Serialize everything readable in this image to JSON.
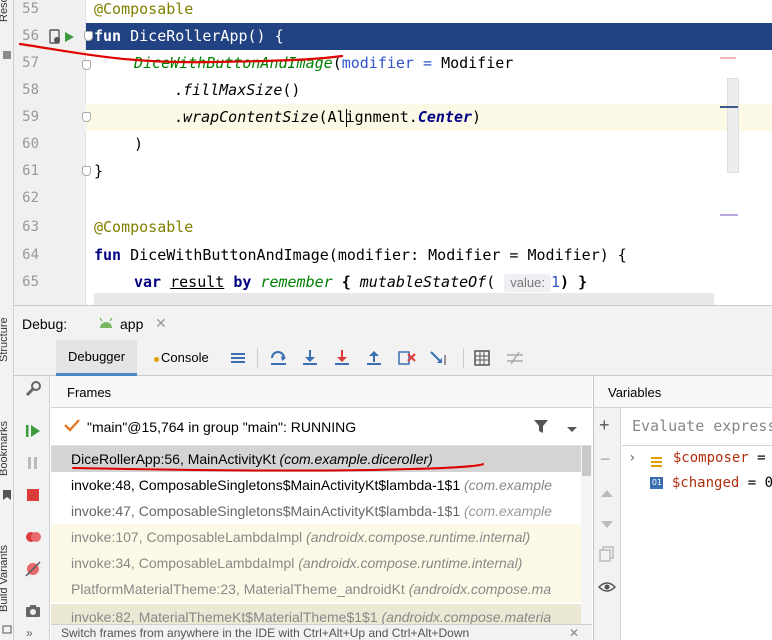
{
  "side_labels": {
    "resource": "Resource",
    "structure": "Structure",
    "bookmarks": "Bookmarks",
    "build_variants": "Build Variants"
  },
  "editor": {
    "lines": [
      {
        "n": "55"
      },
      {
        "n": "56"
      },
      {
        "n": "57"
      },
      {
        "n": "58"
      },
      {
        "n": "59"
      },
      {
        "n": "60"
      },
      {
        "n": "61"
      },
      {
        "n": "62"
      },
      {
        "n": "63"
      },
      {
        "n": "64"
      },
      {
        "n": "65"
      }
    ],
    "code": {
      "l55": "@Composable",
      "l56_kw": "fun",
      "l56_rest": " DiceRollerApp() {",
      "l57_fn": "DiceWithButtonAndImage",
      "l57_p": "(",
      "l57_param": "modifier",
      "l57_eq": " = ",
      "l57_mod": "Modifier",
      "l58_a": ".",
      "l58_b": "fillMaxSize",
      "l58_c": "()",
      "l59_a": ".",
      "l59_b": "wrapContentSize",
      "l59_c": "(Alignment.",
      "l59_d": "Center",
      "l59_e": ")",
      "l60": ")",
      "l61": "}",
      "l63": "@Composable",
      "l64_kw": "fun",
      "l64_rest": " DiceWithButtonAndImage(modifier: Modifier = Modifier) {",
      "l65_kw": "var",
      "l65_result": "result",
      "l65_by": "by",
      "l65_remember": "remember",
      "l65_brace": " { ",
      "l65_msf": "mutableStateOf",
      "l65_paren": "( ",
      "l65_hint": "value:",
      "l65_val": "1",
      "l65_end": ") }"
    }
  },
  "debug": {
    "label": "Debug:",
    "config": "app",
    "tabs": {
      "debugger": "Debugger",
      "console": "Console"
    }
  },
  "frames": {
    "header": "Frames",
    "thread": "\"main\"@15,764 in group \"main\": RUNNING",
    "items": [
      {
        "method": "DiceRollerApp:56, MainActivityKt",
        "pkg": "(com.example.diceroller)"
      },
      {
        "method": "invoke:48, ComposableSingletons$MainActivityKt$lambda-1$1",
        "pkg": "(com.example"
      },
      {
        "method": "invoke:47, ComposableSingletons$MainActivityKt$lambda-1$1",
        "pkg": "(com.example"
      },
      {
        "method": "invoke:107, ComposableLambdaImpl",
        "pkg": "(androidx.compose.runtime.internal)"
      },
      {
        "method": "invoke:34, ComposableLambdaImpl",
        "pkg": "(androidx.compose.runtime.internal)"
      },
      {
        "method": "PlatformMaterialTheme:23, MaterialTheme_androidKt",
        "pkg": "(androidx.compose.ma"
      },
      {
        "method": "invoke:82, MaterialThemeKt$MaterialTheme$1$1",
        "pkg": "(androidx.compose.materia"
      }
    ]
  },
  "variables": {
    "header": "Variables",
    "eval_placeholder": "Evaluate express",
    "items": [
      {
        "name": "$composer",
        "rest": " ="
      },
      {
        "name": "$changed",
        "rest": " = 0"
      }
    ]
  },
  "status": {
    "hint": "Switch frames from anywhere in the IDE with Ctrl+Alt+Up and Ctrl+Alt+Down"
  },
  "colors": {
    "selection": "#214283",
    "annotation_red": "#e00000",
    "library_frame_bg": "#fcfae6",
    "keyword": "#000080"
  }
}
